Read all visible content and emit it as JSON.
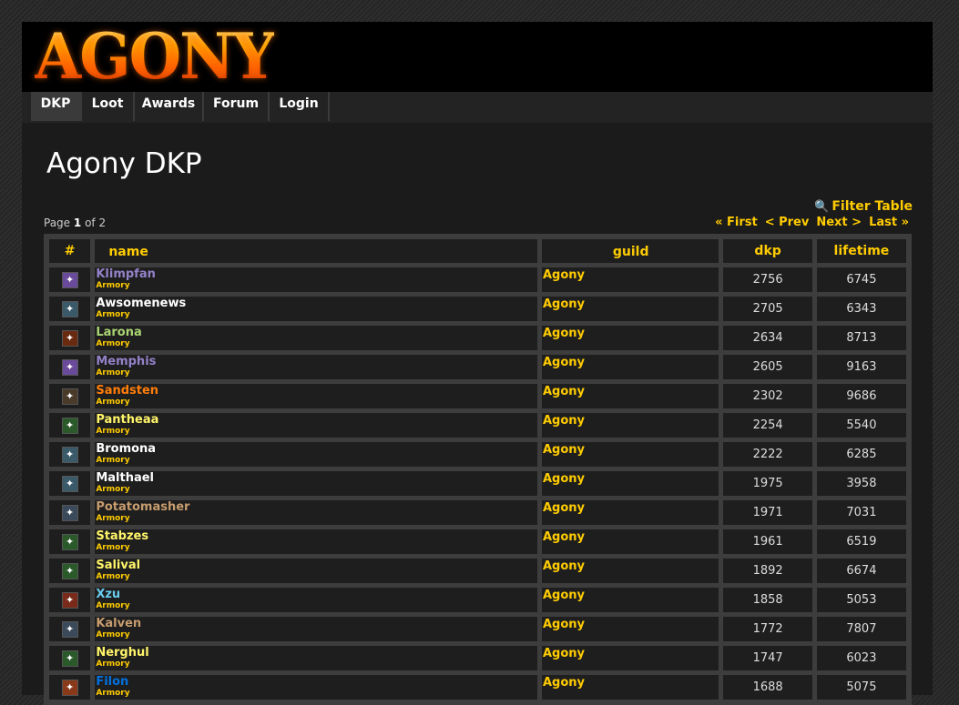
{
  "header": {
    "logo_text": "AGONY"
  },
  "nav": [
    {
      "label": "DKP",
      "active": true
    },
    {
      "label": "Loot",
      "active": false
    },
    {
      "label": "Awards",
      "active": false
    },
    {
      "label": "Forum",
      "active": false
    },
    {
      "label": "Login",
      "active": false
    }
  ],
  "page_title": "Agony DKP",
  "filter": {
    "label": "Filter Table",
    "icon": "magnifier-icon"
  },
  "pagination": {
    "prefix": "Page",
    "current": "1",
    "suffix": "of 2",
    "first": "« First",
    "prev": "< Prev",
    "next": "Next >",
    "last": "Last »"
  },
  "table": {
    "headers": {
      "icon": "#",
      "name": "name",
      "guild": "guild",
      "dkp": "dkp",
      "lifetime": "lifetime"
    },
    "armory_label": "Armory",
    "rows": [
      {
        "name": "Klimpfan",
        "color": "#9482c9",
        "icon": "purple-class-icon",
        "icon_bg": "#6a4a9a",
        "guild": "Agony",
        "dkp": "2756",
        "lifetime": "6745"
      },
      {
        "name": "Awsomenews",
        "color": "#ffffff",
        "icon": "white-class-icon",
        "icon_bg": "#3a5a6a",
        "guild": "Agony",
        "dkp": "2705",
        "lifetime": "6343"
      },
      {
        "name": "Larona",
        "color": "#abd473",
        "icon": "green-class-icon",
        "icon_bg": "#6a2a10",
        "guild": "Agony",
        "dkp": "2634",
        "lifetime": "8713"
      },
      {
        "name": "Memphis",
        "color": "#9482c9",
        "icon": "purple-class-icon",
        "icon_bg": "#6a4a9a",
        "guild": "Agony",
        "dkp": "2605",
        "lifetime": "9163"
      },
      {
        "name": "Sandsten",
        "color": "#ff7d0a",
        "icon": "orange-class-icon",
        "icon_bg": "#4a3a2a",
        "guild": "Agony",
        "dkp": "2302",
        "lifetime": "9686"
      },
      {
        "name": "Pantheaa",
        "color": "#fff569",
        "icon": "yellow-class-icon",
        "icon_bg": "#2a5a2a",
        "guild": "Agony",
        "dkp": "2254",
        "lifetime": "5540"
      },
      {
        "name": "Bromona",
        "color": "#ffffff",
        "icon": "white-class-icon",
        "icon_bg": "#3a5a6a",
        "guild": "Agony",
        "dkp": "2222",
        "lifetime": "6285"
      },
      {
        "name": "Malthael",
        "color": "#ffffff",
        "icon": "white-class-icon",
        "icon_bg": "#3a5a6a",
        "guild": "Agony",
        "dkp": "1975",
        "lifetime": "3958"
      },
      {
        "name": "Potatomasher",
        "color": "#c79c6e",
        "icon": "tan-class-icon",
        "icon_bg": "#3a4a5a",
        "guild": "Agony",
        "dkp": "1971",
        "lifetime": "7031"
      },
      {
        "name": "Stabzes",
        "color": "#fff569",
        "icon": "yellow-class-icon",
        "icon_bg": "#2a5a2a",
        "guild": "Agony",
        "dkp": "1961",
        "lifetime": "6519"
      },
      {
        "name": "Salival",
        "color": "#fff569",
        "icon": "yellow-class-icon",
        "icon_bg": "#2a5a2a",
        "guild": "Agony",
        "dkp": "1892",
        "lifetime": "6674"
      },
      {
        "name": "Xzu",
        "color": "#69ccf0",
        "icon": "blue-class-icon",
        "icon_bg": "#7a2a1a",
        "guild": "Agony",
        "dkp": "1858",
        "lifetime": "5053"
      },
      {
        "name": "Kalven",
        "color": "#c79c6e",
        "icon": "tan-class-icon",
        "icon_bg": "#3a4a5a",
        "guild": "Agony",
        "dkp": "1772",
        "lifetime": "7807"
      },
      {
        "name": "Nerghul",
        "color": "#fff569",
        "icon": "yellow-class-icon",
        "icon_bg": "#2a5a2a",
        "guild": "Agony",
        "dkp": "1747",
        "lifetime": "6023"
      },
      {
        "name": "Filon",
        "color": "#0070de",
        "icon": "blue-shaman-class-icon",
        "icon_bg": "#8a3a1a",
        "guild": "Agony",
        "dkp": "1688",
        "lifetime": "5075"
      }
    ]
  }
}
